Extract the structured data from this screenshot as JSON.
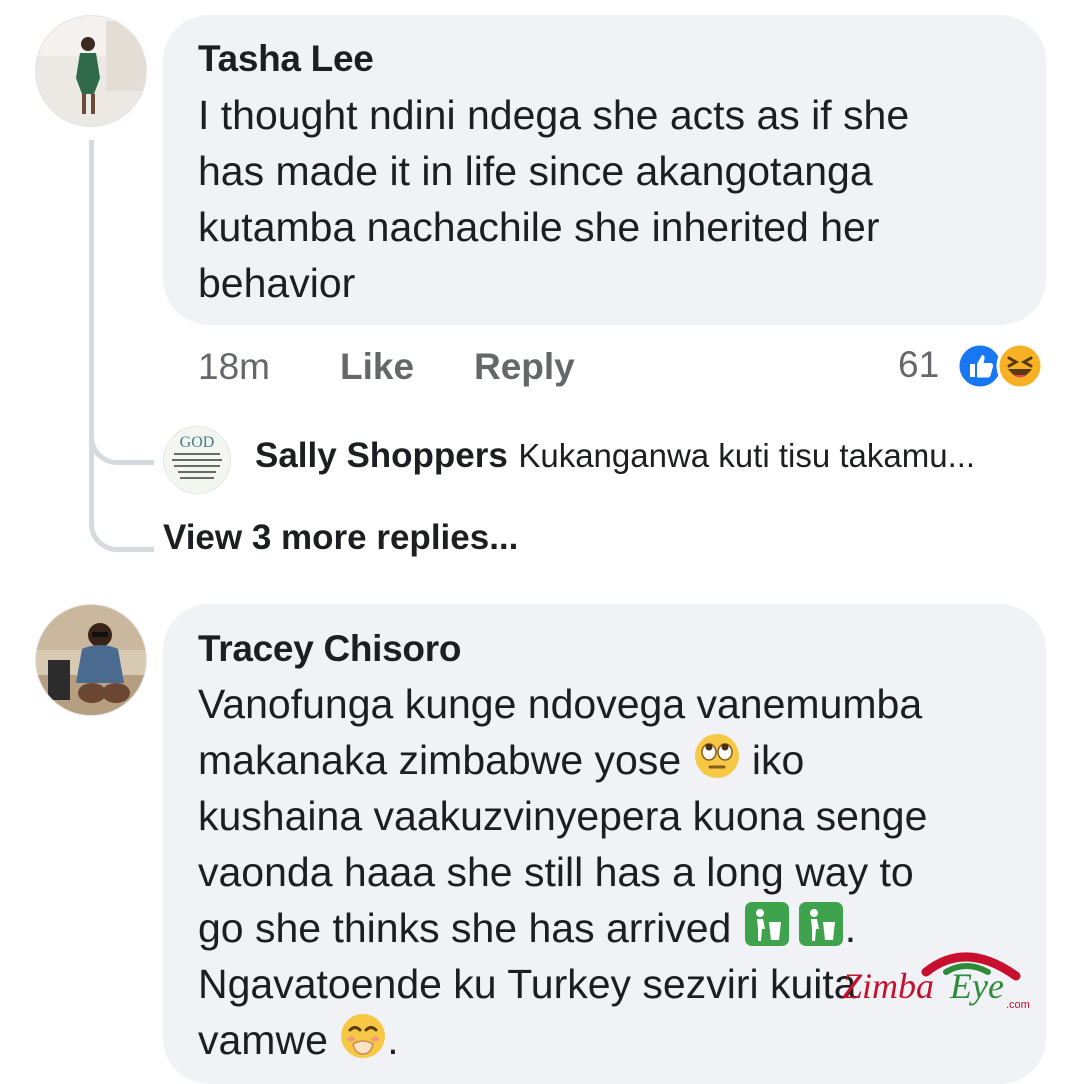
{
  "comments": [
    {
      "author": "Tasha Lee",
      "text": "I thought ndini ndega she acts as if she\nhas made it in life since akangotanga\nkutamba nachachile she inherited her\nbehavior",
      "time": "18m",
      "like_label": "Like",
      "reply_label": "Reply",
      "reaction_count": "61",
      "reactions": [
        "like-icon",
        "haha-icon"
      ],
      "replies_preview": {
        "author": "Sally Shoppers",
        "text": "Kukanganwa kuti tisu takamu...",
        "avatar_text": "GOD"
      },
      "view_more_label": "View 3 more replies..."
    },
    {
      "author": "Tracey Chisoro",
      "line1": "Vanofunga kunge ndovega vanemumba",
      "line2": "makanaka zimbabwe yose ",
      "line2b": " iko",
      "line3": "kushaina vaakuzvinyepera kuona senge",
      "line4": "vaonda haaa she still has a long way to",
      "line5": "go she thinks she has arrived ",
      "line5b": ".",
      "line6": "Ngavatoende ku Turkey sezviri kuita",
      "line7": "vamwe ",
      "line7b": "."
    }
  ],
  "watermark": {
    "brand": "ZimbaEye",
    "domain": ".com"
  },
  "colors": {
    "bubble": "#f0f2f5",
    "like_blue": "#1877f2",
    "haha_yellow": "#f7b125",
    "watermark_red": "#c8102e",
    "watermark_green": "#2e8b3a"
  }
}
